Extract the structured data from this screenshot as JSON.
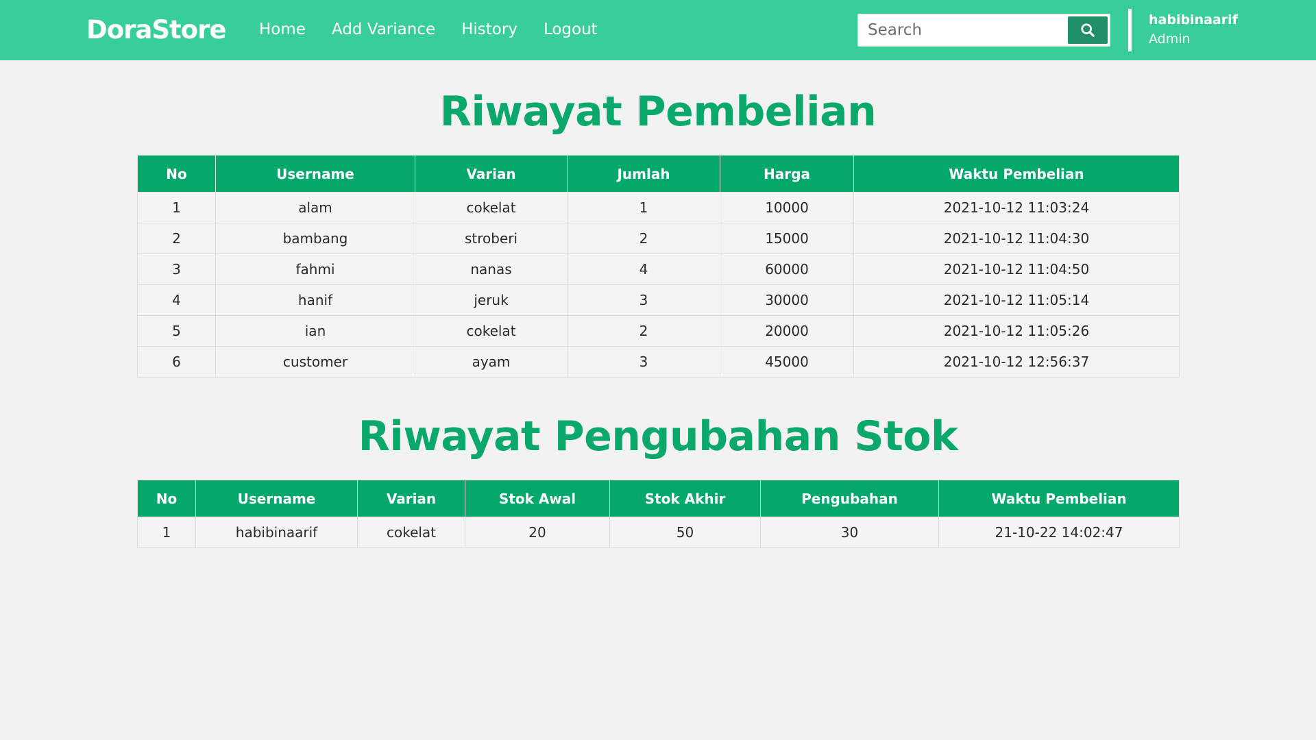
{
  "navbar": {
    "brand": "DoraStore",
    "links": [
      "Home",
      "Add Variance",
      "History",
      "Logout"
    ],
    "search_placeholder": "Search",
    "user": {
      "name": "habibinaarif",
      "role": "Admin"
    },
    "colors": {
      "navbar": "#37ce97",
      "accent": "#04a86a",
      "search_button": "#1f8f68"
    }
  },
  "purchase_history": {
    "title": "Riwayat Pembelian",
    "headers": [
      "No",
      "Username",
      "Varian",
      "Jumlah",
      "Harga",
      "Waktu Pembelian"
    ],
    "rows": [
      [
        "1",
        "alam",
        "cokelat",
        "1",
        "10000",
        "2021-10-12 11:03:24"
      ],
      [
        "2",
        "bambang",
        "stroberi",
        "2",
        "15000",
        "2021-10-12 11:04:30"
      ],
      [
        "3",
        "fahmi",
        "nanas",
        "4",
        "60000",
        "2021-10-12 11:04:50"
      ],
      [
        "4",
        "hanif",
        "jeruk",
        "3",
        "30000",
        "2021-10-12 11:05:14"
      ],
      [
        "5",
        "ian",
        "cokelat",
        "2",
        "20000",
        "2021-10-12 11:05:26"
      ],
      [
        "6",
        "customer",
        "ayam",
        "3",
        "45000",
        "2021-10-12 12:56:37"
      ]
    ]
  },
  "stock_history": {
    "title": "Riwayat Pengubahan Stok",
    "headers": [
      "No",
      "Username",
      "Varian",
      "Stok Awal",
      "Stok Akhir",
      "Pengubahan",
      "Waktu Pembelian"
    ],
    "rows": [
      [
        "1",
        "habibinaarif",
        "cokelat",
        "20",
        "50",
        "30",
        "21-10-22 14:02:47"
      ]
    ]
  }
}
